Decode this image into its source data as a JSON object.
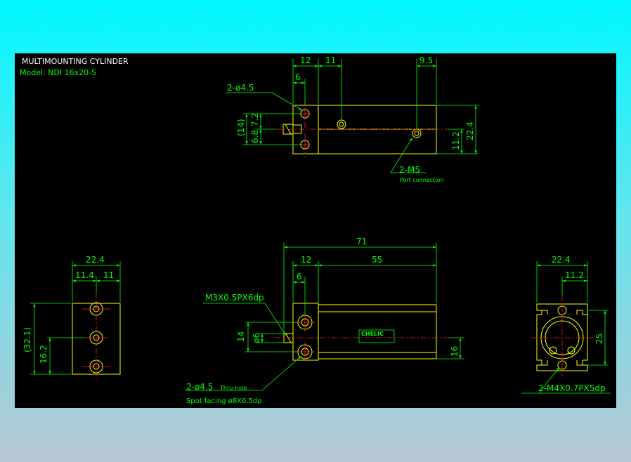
{
  "header": {
    "title": "MULTIMOUNTING CYLINDER",
    "model": "Model: NDI 16x20-S"
  },
  "top_view": {
    "dims": {
      "d12": "12",
      "d11": "11",
      "d9_5": "9.5",
      "d6": "6",
      "d14": "(14)",
      "d7_2": "7.2",
      "d6_8": "6.8",
      "d22_4": "22.4",
      "d11_2": "11.2"
    },
    "hole_callout": "2-ø4.5",
    "port_callout": "2-M5",
    "port_note": "Port connection"
  },
  "front_view": {
    "dims": {
      "d71": "71",
      "d12": "12",
      "d55": "55",
      "d6": "6",
      "d14": "14",
      "d_phi6": "ø6",
      "d16": "16"
    },
    "thread_callout": "M3X0.5PX6dp",
    "hole_callout": "2-ø4.5",
    "thru_note": "Thru-hole",
    "spot_note": "Spot facing  ø8X6.5dp",
    "logo": "CHELIC"
  },
  "left_view": {
    "dims": {
      "d22_4": "22.4",
      "d11_4": "11.4",
      "d11": "11",
      "d32_1": "(32.1)",
      "d16_2": "16.2"
    }
  },
  "right_view": {
    "dims": {
      "d22_4": "22.4",
      "d11_2": "11.2",
      "d25": "25"
    },
    "thread_callout": "2-M4X0.7PX5dp"
  }
}
